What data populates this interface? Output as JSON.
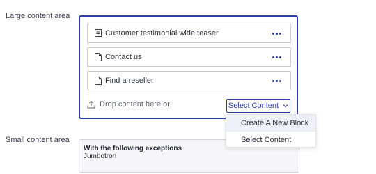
{
  "labels": {
    "large": "Large content area",
    "small": "Small content area"
  },
  "large_area": {
    "blocks": [
      {
        "title": "Customer testimonial wide teaser",
        "icon": "layout-block-icon"
      },
      {
        "title": "Contact us",
        "icon": "page-icon"
      },
      {
        "title": "Find a reseller",
        "icon": "page-icon"
      }
    ],
    "drop_text": "Drop content here or",
    "select_button": "Select Content"
  },
  "dropdown_menu": {
    "items": [
      "Create A New Block",
      "Select Content"
    ],
    "hovered_index": 0
  },
  "small_area": {
    "heading": "With the following exceptions",
    "item": "Jumbotron"
  },
  "colors": {
    "accent": "#2d3fa6",
    "border": "#c9ccd6"
  }
}
